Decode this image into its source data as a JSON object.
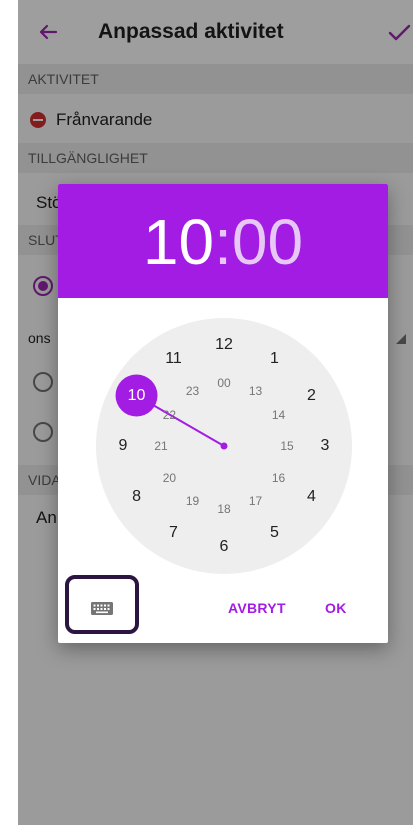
{
  "app_bar": {
    "title": "Anpassad aktivitet",
    "back_icon": "arrow-left-icon",
    "confirm_icon": "checkmark-icon"
  },
  "sections": {
    "aktivitet_header": "AKTIVITET",
    "activity_value": "Frånvarande",
    "tillganglighet_header": "TILLGÄNGLIGHET",
    "availability_value_partial": "Stö",
    "slut_header_partial": "SLUT",
    "date_partial": "ons",
    "vidare_header_partial": "VIDA",
    "more_partial": "An"
  },
  "time_picker": {
    "hour": "10",
    "separator": ":",
    "minute": "00",
    "selected_hour": 10,
    "outer_hours": [
      "12",
      "1",
      "2",
      "3",
      "4",
      "5",
      "6",
      "7",
      "8",
      "9",
      "10",
      "11"
    ],
    "inner_hours": [
      "00",
      "13",
      "14",
      "15",
      "16",
      "17",
      "18",
      "19",
      "20",
      "21",
      "22",
      "23"
    ],
    "keyboard_icon": "keyboard-icon",
    "cancel_label": "AVBRYT",
    "ok_label": "OK"
  },
  "colors": {
    "accent": "#a21ce3",
    "header_minute": "#e6c7f5",
    "focus_outline": "#2a1640",
    "status_red": "#d32f2f"
  }
}
